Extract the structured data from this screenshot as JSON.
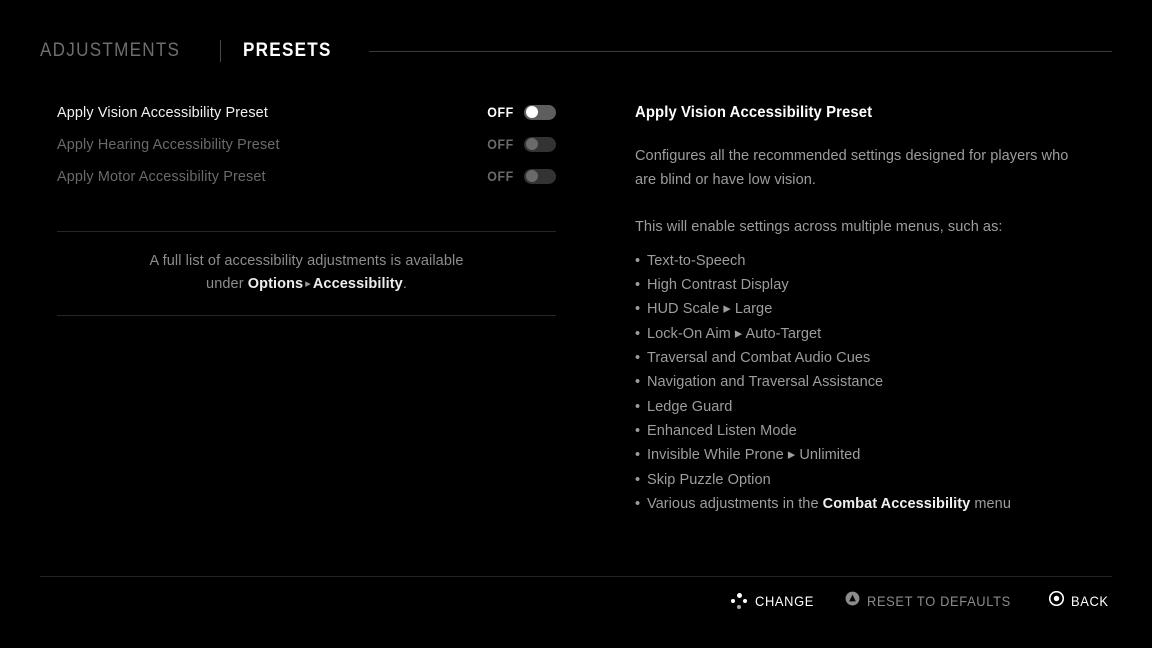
{
  "tabs": [
    {
      "label": "ADJUSTMENTS",
      "active": false
    },
    {
      "label": "PRESETS",
      "active": true
    }
  ],
  "settings": {
    "rows": [
      {
        "label": "Apply Vision Accessibility Preset",
        "state": "OFF",
        "enabled": true,
        "selected": true
      },
      {
        "label": "Apply Hearing Accessibility Preset",
        "state": "OFF",
        "enabled": false,
        "selected": false
      },
      {
        "label": "Apply Motor Accessibility Preset",
        "state": "OFF",
        "enabled": false,
        "selected": false
      }
    ]
  },
  "hint": {
    "line1": "A full list of accessibility adjustments is available",
    "line2_prefix": "under ",
    "line2_bold1": "Options",
    "line2_caret": "▸",
    "line2_bold2": "Accessibility",
    "line2_suffix": "."
  },
  "detail": {
    "title": "Apply Vision Accessibility Preset",
    "paragraph1": "Configures all the recommended settings designed for players who are blind or have low vision.",
    "paragraph2": "This will enable settings across multiple menus, such as:",
    "bullet_char": "•",
    "caret_char": "▸",
    "bullets": [
      {
        "text": "Text-to-Speech"
      },
      {
        "text": "High Contrast Display"
      },
      {
        "text": "HUD Scale ▸ Large"
      },
      {
        "text": "Lock-On Aim ▸ Auto-Target"
      },
      {
        "text": "Traversal and Combat Audio Cues"
      },
      {
        "text": "Navigation and Traversal Assistance"
      },
      {
        "text": "Ledge Guard"
      },
      {
        "text": "Enhanced Listen Mode"
      },
      {
        "text": "Invisible While Prone ▸ Unlimited"
      },
      {
        "text": "Skip Puzzle Option"
      },
      {
        "prefix": "Various adjustments in the ",
        "bold": "Combat Accessibility",
        "suffix": " menu"
      }
    ]
  },
  "footer": {
    "prompts": [
      {
        "icon": "dpad-icon",
        "label": "CHANGE",
        "style": "bright"
      },
      {
        "icon": "playstation-triangle-icon",
        "label": "RESET TO DEFAULTS",
        "style": "dim"
      },
      {
        "icon": "playstation-circle-icon",
        "label": "BACK",
        "style": "bright"
      }
    ]
  },
  "colors": {
    "background": "#000000",
    "text_primary": "#f2f2f2",
    "text_secondary": "#9d9d9d",
    "text_disabled": "#6a6a6a",
    "divider": "#262626",
    "toggle_track_on": "#5e5e5e",
    "toggle_track_off": "#333333",
    "knob_active": "#ffffff"
  }
}
